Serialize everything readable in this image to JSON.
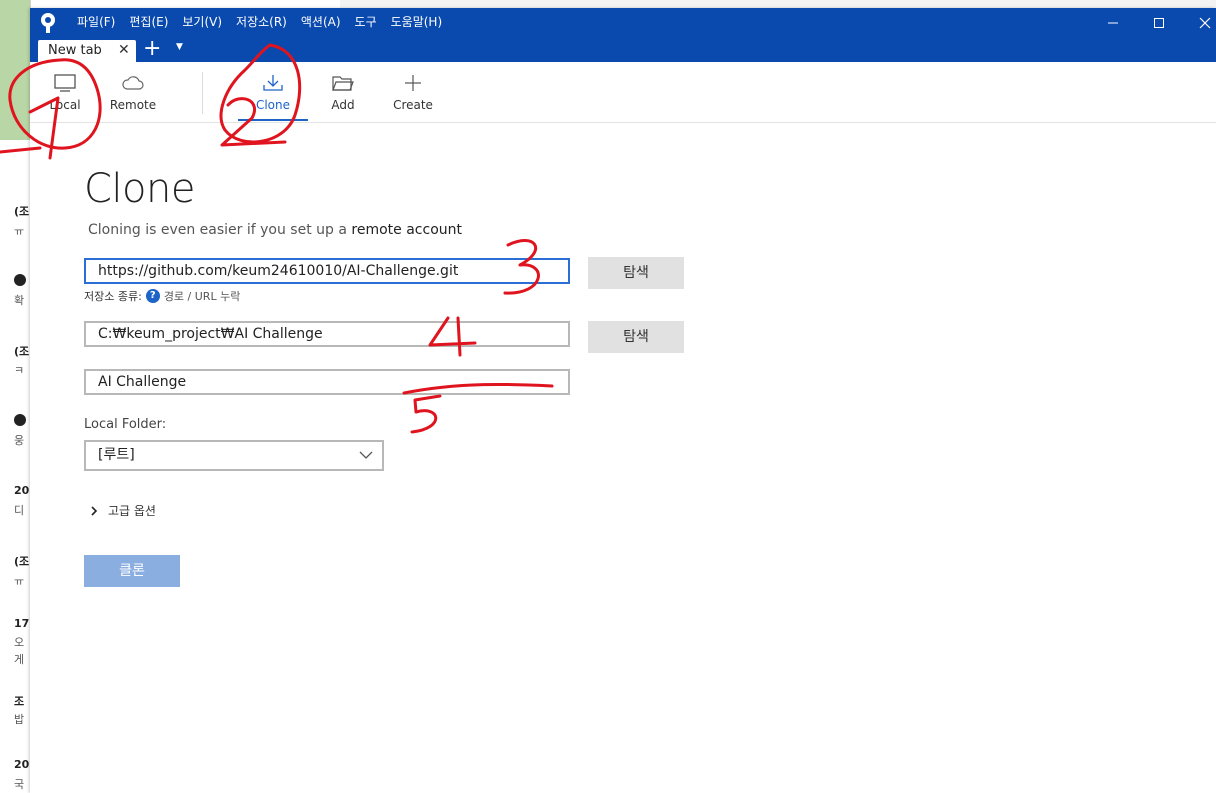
{
  "menu": [
    "파일(F)",
    "편집(E)",
    "보기(V)",
    "저장소(R)",
    "액션(A)",
    "도구",
    "도움말(H)"
  ],
  "tab": {
    "label": "New tab"
  },
  "toolbar": {
    "local": "Local",
    "remote": "Remote",
    "clone": "Clone",
    "add": "Add",
    "create": "Create"
  },
  "page": {
    "title": "Clone",
    "subtitle_prefix": "Cloning is even easier if you set up a ",
    "subtitle_link": "remote account"
  },
  "form": {
    "source_url": "https://github.com/keum24610010/AI-Challenge.git",
    "browse_label": "탐색",
    "repo_type_label": "저장소 종류:",
    "repo_type_value": "경로 / URL 누락",
    "dest_path": "C:₩keum_project₩AI Challenge",
    "name": "AI Challenge",
    "local_folder_label": "Local Folder:",
    "local_folder_value": "[루트]",
    "advanced_label": "고급 옵션",
    "clone_button": "클론"
  },
  "annotations": [
    "1",
    "2",
    "3",
    "4",
    "5"
  ],
  "background_window": {
    "rows": [
      "(조",
      "ㅠ",
      "확",
      "(조",
      "ㅋ",
      "웅",
      "20",
      "디",
      "(조",
      "ㅠ",
      "17",
      "오",
      "게",
      "조",
      "밥",
      "20",
      "국"
    ]
  },
  "colors": {
    "titlebar": "#0a49ad",
    "accent": "#1d64c8",
    "clone_button": "#8aaee0",
    "annotation": "#e0141e"
  }
}
